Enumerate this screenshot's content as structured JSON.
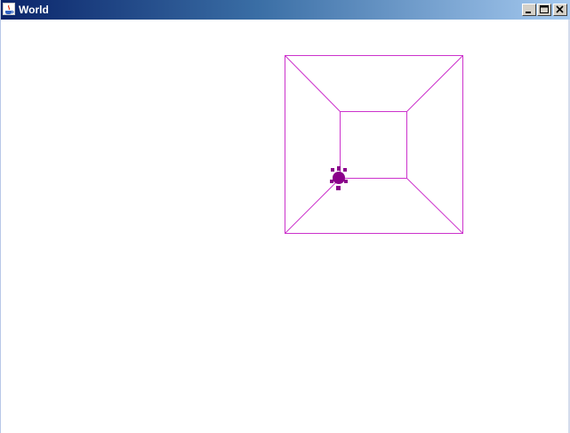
{
  "window": {
    "title": "World",
    "icon": "java-cup-icon",
    "controls": [
      "minimize-icon",
      "maximize-icon",
      "close-icon"
    ]
  },
  "world": {
    "line_color": "#cc33cc",
    "turtle_color": "#8b008b",
    "title_gradient": [
      "#0a246a",
      "#3a6ea5",
      "#a6caf0"
    ]
  }
}
